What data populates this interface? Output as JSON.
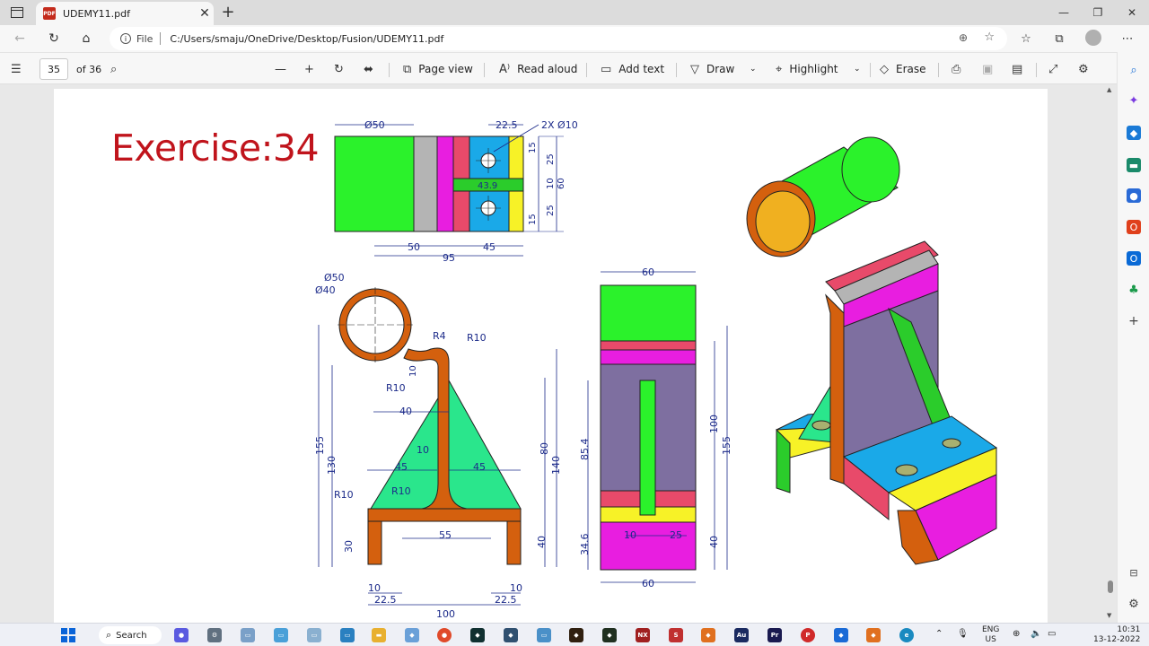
{
  "tab": {
    "title": "UDEMY11.pdf",
    "icon": "pdf-icon"
  },
  "address": {
    "scheme": "File",
    "url": "C:/Users/smaju/OneDrive/Desktop/Fusion/UDEMY11.pdf"
  },
  "toolbar": {
    "page_current": "35",
    "page_total": "of 36",
    "page_view": "Page view",
    "read_aloud": "Read aloud",
    "add_text": "Add text",
    "draw": "Draw",
    "highlight": "Highlight",
    "erase": "Erase"
  },
  "document": {
    "title": "Exercise:34",
    "top_view": {
      "dims": [
        "Ø50",
        "22.5",
        "2X Ø10",
        "15",
        "25",
        "10",
        "60",
        "43.9",
        "25",
        "15",
        "50",
        "45",
        "95"
      ]
    },
    "front_view": {
      "dims": [
        "Ø50",
        "Ø40",
        "R4",
        "R10",
        "10",
        "R10",
        "40",
        "155",
        "130",
        "10",
        "45",
        "45",
        "80",
        "140",
        "R10",
        "R10",
        "55",
        "30",
        "40",
        "10",
        "22.5",
        "10",
        "22.5",
        "100"
      ]
    },
    "side_view": {
      "dims": [
        "60",
        "100",
        "155",
        "85.4",
        "10",
        "25",
        "34.6",
        "40",
        "60"
      ]
    }
  },
  "taskbar": {
    "search": "Search",
    "lang_top": "ENG",
    "lang_bottom": "US",
    "time": "10:31",
    "date": "13-12-2022"
  },
  "colors": {
    "green": "#2bf22b",
    "magenta": "#e81ee0",
    "orange": "#d4600e",
    "blue": "#1aa9e8",
    "yellow": "#f7f227",
    "pink": "#e84a6a",
    "purple": "#7e6fa0",
    "gray": "#b4b4b4",
    "mint": "#2ae68c",
    "title_red": "#c0141c",
    "dim_blue": "#1c2b8a"
  }
}
